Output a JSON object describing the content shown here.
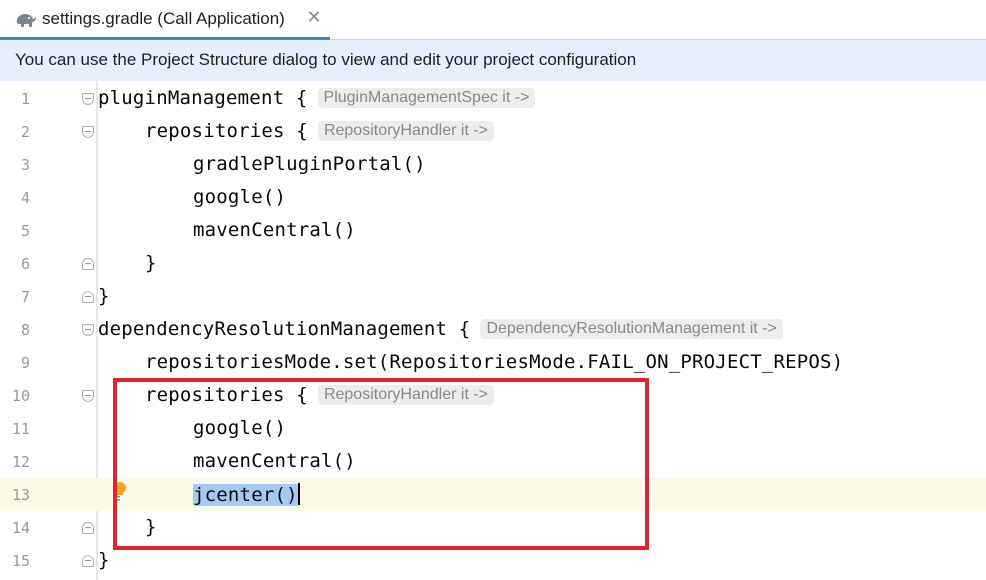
{
  "tab": {
    "title": "settings.gradle (Call Application)",
    "close_glyph": "✕",
    "icon": "gradle-elephant-icon"
  },
  "banner": {
    "text": "You can use the Project Structure dialog to view and edit your project configuration"
  },
  "editor": {
    "current_line": 13,
    "lines": [
      {
        "num": "1",
        "code": "pluginManagement {",
        "hint": "PluginManagementSpec it ->"
      },
      {
        "num": "2",
        "code": "repositories {",
        "hint": "RepositoryHandler it ->"
      },
      {
        "num": "3",
        "code": "gradlePluginPortal()",
        "hint": ""
      },
      {
        "num": "4",
        "code": "google()",
        "hint": ""
      },
      {
        "num": "5",
        "code": "mavenCentral()",
        "hint": ""
      },
      {
        "num": "6",
        "code": "}",
        "hint": ""
      },
      {
        "num": "7",
        "code": "}",
        "hint": ""
      },
      {
        "num": "8",
        "code": "dependencyResolutionManagement {",
        "hint": "DependencyResolutionManagement it ->"
      },
      {
        "num": "9",
        "code": "repositoriesMode.set(RepositoriesMode.FAIL_ON_PROJECT_REPOS)",
        "hint": ""
      },
      {
        "num": "10",
        "code": "repositories {",
        "hint": "RepositoryHandler it ->"
      },
      {
        "num": "11",
        "code": "google()",
        "hint": ""
      },
      {
        "num": "12",
        "code": "mavenCentral()",
        "hint": ""
      },
      {
        "num": "13",
        "code": "jcenter",
        "selected": "()",
        "hint": ""
      },
      {
        "num": "14",
        "code": "}",
        "hint": ""
      },
      {
        "num": "15",
        "code": "}",
        "hint": ""
      }
    ]
  },
  "colors": {
    "highlight_border": "#e0242e",
    "tab_underline": "#4083c9",
    "banner_bg": "#e5eefa",
    "current_line_bg": "#fcfae8",
    "selection_bg": "#a6c9f2"
  }
}
